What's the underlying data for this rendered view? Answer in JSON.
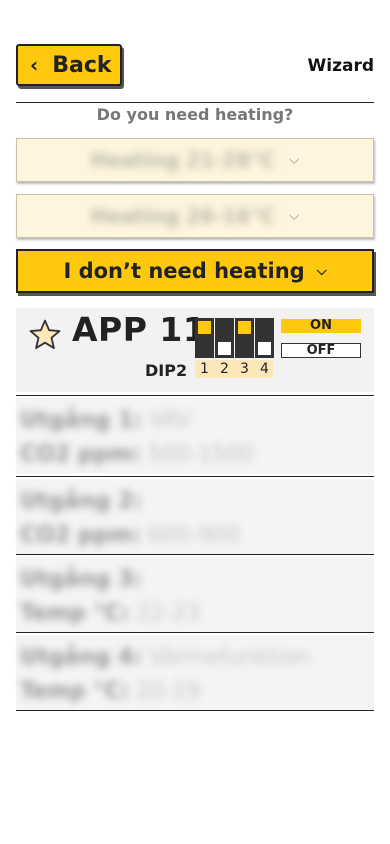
{
  "header": {
    "back_label": "Back",
    "title": "Wizard"
  },
  "question": "Do you need heating?",
  "heating_options": [
    {
      "label": "Heating 21-28°C"
    },
    {
      "label": "Heating 26-16°C"
    }
  ],
  "no_heating_label": "I don’t need heating",
  "app": {
    "title": "APP 11",
    "dip_label": "DIP2",
    "switches": [
      {
        "num": "1",
        "state": "on"
      },
      {
        "num": "2",
        "state": "off"
      },
      {
        "num": "3",
        "state": "on"
      },
      {
        "num": "4",
        "state": "off"
      }
    ],
    "on_label": "ON",
    "off_label": "OFF"
  },
  "outputs": [
    {
      "title": "Utgång 1:",
      "title_value": "VAV",
      "detail": "CO2 ppm:",
      "detail_value": "500-1500"
    },
    {
      "title": "Utgång 2:",
      "title_value": "",
      "detail": "CO2 ppm:",
      "detail_value": "600-900"
    },
    {
      "title": "Utgång 3:",
      "title_value": "",
      "detail": "Temp °C:",
      "detail_value": "22-23"
    },
    {
      "title": "Utgång 4:",
      "title_value": "Värmefunktion",
      "detail": "Temp °C:",
      "detail_value": "20-19"
    }
  ],
  "colors": {
    "accent": "#fdc80d",
    "dip_on_num_bg": "#fbe7b8"
  },
  "icons": {
    "back": "chevron-left-icon",
    "dropdown": "chevron-down-icon",
    "favorite": "star-icon"
  }
}
